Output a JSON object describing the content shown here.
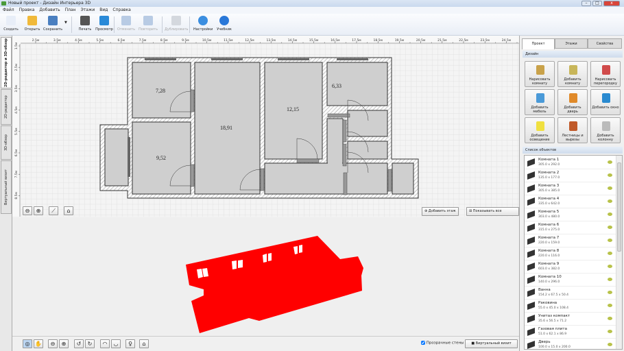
{
  "window": {
    "title": "Новый проект - Дизайн Интерьера 3D"
  },
  "menu": [
    "Файл",
    "Правка",
    "Добавить",
    "План",
    "Этажи",
    "Вид",
    "Справка"
  ],
  "toolbar": [
    {
      "label": "Создать",
      "icon": "new-file-icon",
      "color": "#e8eef8",
      "disabled": false
    },
    {
      "label": "Открыть",
      "icon": "folder-icon",
      "color": "#f0b93a",
      "disabled": false
    },
    {
      "label": "Сохранить",
      "icon": "floppy-icon",
      "color": "#4a7fc0",
      "disabled": false
    },
    {
      "label": "Печать",
      "icon": "printer-icon",
      "color": "#555",
      "disabled": false
    },
    {
      "label": "Просмотр",
      "icon": "monitor-icon",
      "color": "#2a8ad8",
      "disabled": false
    },
    {
      "label": "Отменить",
      "icon": "undo-icon",
      "color": "#b8cbe4",
      "disabled": true
    },
    {
      "label": "Повторить",
      "icon": "redo-icon",
      "color": "#b8cbe4",
      "disabled": true
    },
    {
      "label": "Дублировать",
      "icon": "duplicate-icon",
      "color": "#d4d8de",
      "disabled": true
    },
    {
      "label": "Настройки",
      "icon": "gear-icon",
      "color": "#3b8ee0",
      "disabled": false
    },
    {
      "label": "Учебник",
      "icon": "help-icon",
      "color": "#2a78d8",
      "disabled": false
    }
  ],
  "left_tabs": [
    "2D-редактор и 3D-обзор",
    "2D-редактор",
    "3D-обзор",
    "Виртуальный визит"
  ],
  "ruler": {
    "x_labels": [
      "2.5м",
      "3.5м",
      "4.5м",
      "5.5м",
      "6.5м",
      "7.5м",
      "8.5м",
      "9.5м",
      "10.5м",
      "11.5м",
      "12.5м",
      "13.5м",
      "14.5м",
      "15.5м",
      "16.5м",
      "17.5м",
      "18.5м",
      "19.5м",
      "20.5м",
      "21.5м",
      "22.5м",
      "23.5м",
      "24.5м"
    ],
    "y_labels": [
      "1.5м",
      "2.5м",
      "3.5м",
      "4.5м",
      "5.5м",
      "6.5м",
      "7.5м",
      "8.5м"
    ]
  },
  "plan": {
    "room_areas": [
      "7,28",
      "9,52",
      "18,91",
      "12,15",
      "6,33"
    ],
    "add_floor": "Добавить этаж",
    "show_sizes": "Показывать все размеры"
  },
  "view3d": {
    "model_color": "#ff0000",
    "transparent_walls_label": "Прозрачные стены",
    "transparent_walls_checked": true,
    "virtual_visit": "Виртуальный визит"
  },
  "right_panel": {
    "tabs": [
      "Проект",
      "Этажи",
      "Свойства"
    ],
    "design_header": "Дизайн",
    "design_buttons": [
      {
        "label": "Нарисовать комнату",
        "icon": "pencil-cup-icon",
        "color": "#c9a24a"
      },
      {
        "label": "Добавить комнату",
        "icon": "add-room-icon",
        "color": "#c8b65a"
      },
      {
        "label": "Нарисовать перегородку",
        "icon": "brick-wall-icon",
        "color": "#d04a4a"
      },
      {
        "label": "Добавить мебель",
        "icon": "armchair-icon",
        "color": "#4a9ad8"
      },
      {
        "label": "Добавить дверь",
        "icon": "door-icon",
        "color": "#e08a2a"
      },
      {
        "label": "Добавить окно",
        "icon": "window-icon",
        "color": "#2a8ad0"
      },
      {
        "label": "Добавить освещение",
        "icon": "bulb-icon",
        "color": "#f0e040"
      },
      {
        "label": "Лестницы и вырезы",
        "icon": "stairs-icon",
        "color": "#c05a2a"
      },
      {
        "label": "Добавить колонну",
        "icon": "column-icon",
        "color": "#bbbbbb"
      }
    ],
    "objects_header": "Список объектов",
    "objects": [
      {
        "name": "Комната 1",
        "size": "305.0 x 292.0"
      },
      {
        "name": "Комната 2",
        "size": "135.0 x 177.0"
      },
      {
        "name": "Комната 3",
        "size": "305.0 x 385.0"
      },
      {
        "name": "Комната 4",
        "size": "335.0 x 642.0"
      },
      {
        "name": "Комната 5",
        "size": "303.0 x 480.0"
      },
      {
        "name": "Комната 6",
        "size": "315.0 x 275.0"
      },
      {
        "name": "Комната 7",
        "size": "220.0 x 159.0"
      },
      {
        "name": "Комната 8",
        "size": "220.0 x 116.0"
      },
      {
        "name": "Комната 9",
        "size": "603.0 x 382.0"
      },
      {
        "name": "Комната 10",
        "size": "140.0 x 296.0"
      },
      {
        "name": "Ванна",
        "size": "154.2 x 67.5 x 50.4"
      },
      {
        "name": "Раковина",
        "size": "55.0 x 45.0 x 108.4"
      },
      {
        "name": "Унитаз компакт",
        "size": "35.6 x 56.5 x 71.2"
      },
      {
        "name": "Газовая плита",
        "size": "51.0 x 62.1 x 86.9"
      },
      {
        "name": "Дверь",
        "size": "100.0 x 15.0 x 200.0"
      }
    ]
  }
}
